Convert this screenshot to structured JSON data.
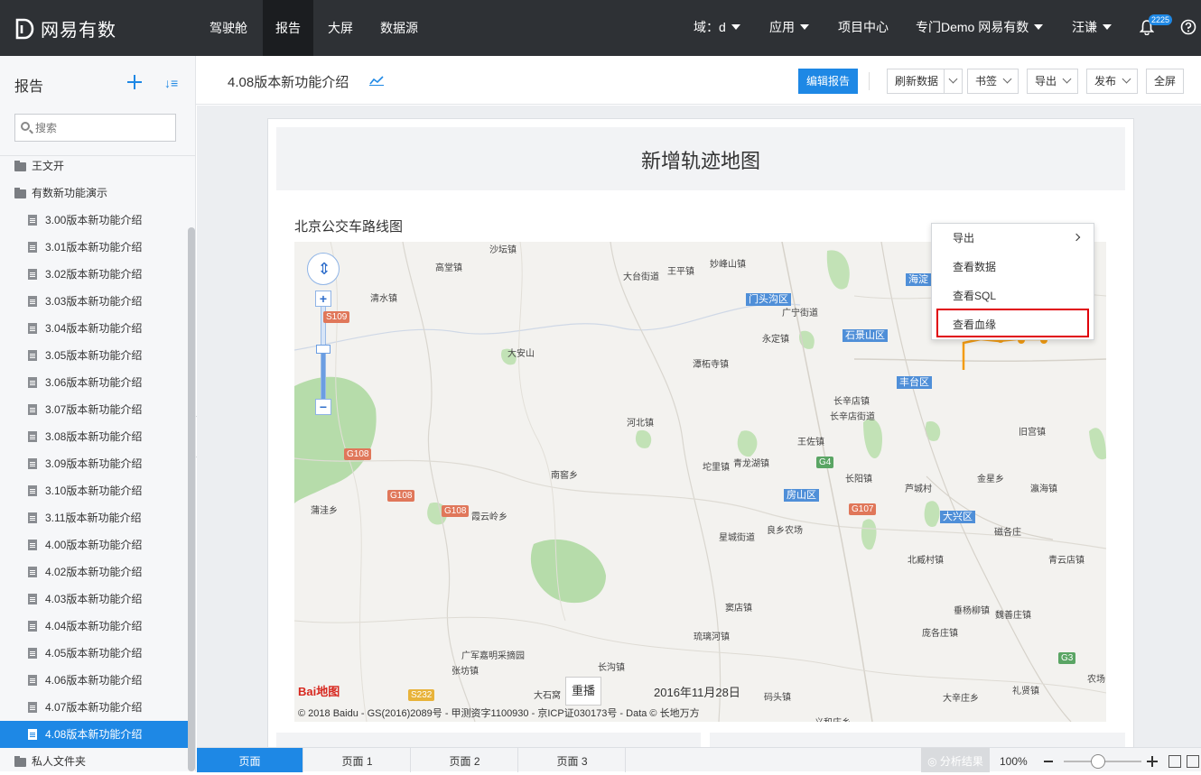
{
  "brand": {
    "name": "网易有数"
  },
  "nav": {
    "items": [
      "驾驶舱",
      "报告",
      "大屏",
      "数据源"
    ],
    "domain_label": "域：d",
    "apps_label": "应用",
    "project_center": "项目中心",
    "org_label": "专门Demo 网易有数",
    "user_label": "汪谦",
    "notification_count": "2225"
  },
  "sidebar": {
    "title": "报告",
    "search_placeholder": "搜索",
    "folders": [
      "王文开",
      "有数新功能演示"
    ],
    "docs": [
      "3.00版本新功能介绍",
      "3.01版本新功能介绍",
      "3.02版本新功能介绍",
      "3.03版本新功能介绍",
      "3.04版本新功能介绍",
      "3.05版本新功能介绍",
      "3.06版本新功能介绍",
      "3.07版本新功能介绍",
      "3.08版本新功能介绍",
      "3.09版本新功能介绍",
      "3.10版本新功能介绍",
      "3.11版本新功能介绍",
      "4.00版本新功能介绍",
      "4.02版本新功能介绍",
      "4.03版本新功能介绍",
      "4.04版本新功能介绍",
      "4.05版本新功能介绍",
      "4.06版本新功能介绍",
      "4.07版本新功能介绍",
      "4.08版本新功能介绍"
    ],
    "private_folder": "私人文件夹"
  },
  "toolbar": {
    "report_title": "4.08版本新功能介绍",
    "edit_report": "编辑报告",
    "refresh_data": "刷新数据",
    "bookmark": "书签",
    "export": "导出",
    "publish": "发布",
    "fullscreen": "全屏"
  },
  "report": {
    "page_title": "新增轨迹地图",
    "map_title": "北京公交车路线图",
    "replay_label": "重播",
    "replay_date": "2016年11月28日",
    "copyright": "© 2018 Baidu - GS(2016)2089号 - 甲测资字1100930 - 京ICP证030173号 - Data © 长地万方",
    "baidu_logo": "Bai地图",
    "places": [
      "高堂镇",
      "清水镇",
      "大台街道",
      "王平镇",
      "妙峰山镇",
      "广宁街道",
      "永定镇",
      "大安山",
      "潭柘寺镇",
      "长辛店镇",
      "长辛店街道",
      "河北镇",
      "王佐镇",
      "旧宫镇",
      "南窖乡",
      "坨里镇",
      "青龙湖镇",
      "长阳镇",
      "芦城村",
      "金星乡",
      "瀛海镇",
      "蒲洼乡",
      "霞云岭乡",
      "良乡农场",
      "星城街道",
      "磁各庄",
      "北臧村镇",
      "青云店镇",
      "窦店镇",
      "垂杨柳镇",
      "魏善庄镇",
      "琉璃河镇",
      "庞各庄镇",
      "广军嘉明采摘园",
      "张坊镇",
      "长沟镇",
      "礼贤镇",
      "大石窝",
      "码头镇",
      "大辛庄乡",
      "农场",
      "沙坛镇",
      "义和庄乡"
    ],
    "districts": [
      "门头沟区",
      "石景山区",
      "丰台区",
      "房山区",
      "大兴区",
      "海淀"
    ],
    "roads": [
      "S109",
      "G108",
      "G108",
      "G108",
      "G4",
      "G107",
      "S232",
      "G3"
    ]
  },
  "context_menu": {
    "items": [
      "导出",
      "查看数据",
      "查看SQL",
      "查看血缘"
    ]
  },
  "bottombar": {
    "tabs": [
      "页面",
      "页面 1",
      "页面 2",
      "页面 3"
    ],
    "analysis_results": "分析结果",
    "zoom_level": "100%"
  },
  "colors": {
    "accent": "#1e88e5",
    "topbar": "#2e3135",
    "highlight_border": "#e0000a",
    "route": "#f39c12"
  }
}
